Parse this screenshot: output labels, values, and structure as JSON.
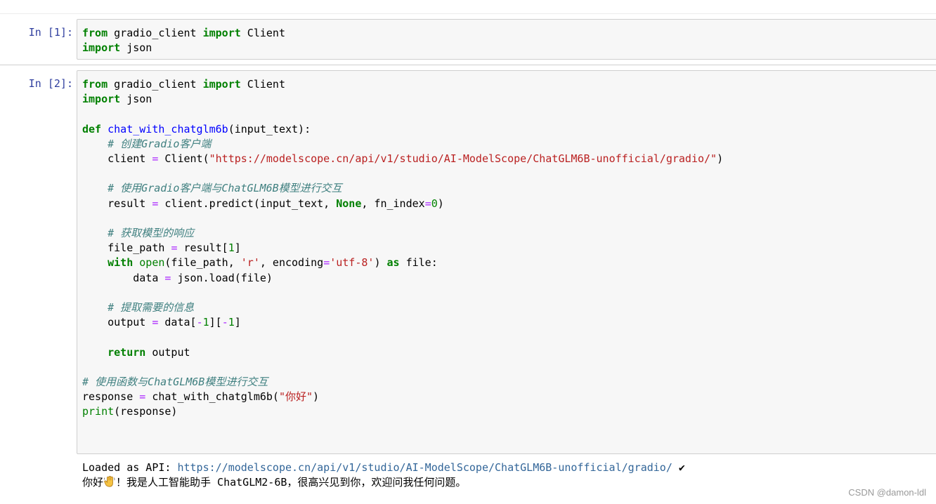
{
  "cells": [
    {
      "prompt": "In  [1]:",
      "code_lines": [
        [
          [
            "kw",
            "from"
          ],
          [
            "t",
            " gradio_client "
          ],
          [
            "kw",
            "import"
          ],
          [
            "t",
            " Client"
          ]
        ],
        [
          [
            "kw",
            "import"
          ],
          [
            "t",
            " json"
          ]
        ]
      ]
    },
    {
      "prompt": "In  [2]:",
      "code_lines": [
        [
          [
            "kw",
            "from"
          ],
          [
            "t",
            " gradio_client "
          ],
          [
            "kw",
            "import"
          ],
          [
            "t",
            " Client"
          ]
        ],
        [
          [
            "kw",
            "import"
          ],
          [
            "t",
            " json"
          ]
        ],
        [],
        [
          [
            "kw",
            "def"
          ],
          [
            "t",
            " "
          ],
          [
            "fn",
            "chat_with_chatglm6b"
          ],
          [
            "t",
            "(input_text):"
          ]
        ],
        [
          [
            "t",
            "    "
          ],
          [
            "cm",
            "# 创建Gradio客户端"
          ]
        ],
        [
          [
            "t",
            "    client "
          ],
          [
            "op",
            "="
          ],
          [
            "t",
            " Client("
          ],
          [
            "str",
            "\"https://modelscope.cn/api/v1/studio/AI-ModelScope/ChatGLM6B-unofficial/gradio/\""
          ],
          [
            "t",
            ")"
          ]
        ],
        [],
        [
          [
            "t",
            "    "
          ],
          [
            "cm",
            "# 使用Gradio客户端与ChatGLM6B模型进行交互"
          ]
        ],
        [
          [
            "t",
            "    result "
          ],
          [
            "op",
            "="
          ],
          [
            "t",
            " client.predict(input_text, "
          ],
          [
            "kw",
            "None"
          ],
          [
            "t",
            ", fn_index"
          ],
          [
            "op",
            "="
          ],
          [
            "num",
            "0"
          ],
          [
            "t",
            ")"
          ]
        ],
        [],
        [
          [
            "t",
            "    "
          ],
          [
            "cm",
            "# 获取模型的响应"
          ]
        ],
        [
          [
            "t",
            "    file_path "
          ],
          [
            "op",
            "="
          ],
          [
            "t",
            " result["
          ],
          [
            "num",
            "1"
          ],
          [
            "t",
            "]"
          ]
        ],
        [
          [
            "t",
            "    "
          ],
          [
            "kw",
            "with"
          ],
          [
            "t",
            " "
          ],
          [
            "bi",
            "open"
          ],
          [
            "t",
            "(file_path, "
          ],
          [
            "str",
            "'r'"
          ],
          [
            "t",
            ", encoding"
          ],
          [
            "op",
            "="
          ],
          [
            "str",
            "'utf-8'"
          ],
          [
            "t",
            ") "
          ],
          [
            "kw",
            "as"
          ],
          [
            "t",
            " file:"
          ]
        ],
        [
          [
            "t",
            "        data "
          ],
          [
            "op",
            "="
          ],
          [
            "t",
            " json.load(file)"
          ]
        ],
        [],
        [
          [
            "t",
            "    "
          ],
          [
            "cm",
            "# 提取需要的信息"
          ]
        ],
        [
          [
            "t",
            "    output "
          ],
          [
            "op",
            "="
          ],
          [
            "t",
            " data["
          ],
          [
            "op",
            "-"
          ],
          [
            "num",
            "1"
          ],
          [
            "t",
            "]["
          ],
          [
            "op",
            "-"
          ],
          [
            "num",
            "1"
          ],
          [
            "t",
            "]"
          ]
        ],
        [],
        [
          [
            "t",
            "    "
          ],
          [
            "kw",
            "return"
          ],
          [
            "t",
            " output"
          ]
        ],
        [],
        [
          [
            "cm",
            "# 使用函数与ChatGLM6B模型进行交互"
          ]
        ],
        [
          [
            "t",
            "response "
          ],
          [
            "op",
            "="
          ],
          [
            "t",
            " chat_with_chatglm6b("
          ],
          [
            "str",
            "\"你好\""
          ],
          [
            "t",
            ")"
          ]
        ],
        [
          [
            "bi",
            "print"
          ],
          [
            "t",
            "(response)"
          ]
        ]
      ]
    }
  ],
  "output": {
    "loaded_prefix": "Loaded as API: ",
    "loaded_url": "https://modelscope.cn/api/v1/studio/AI-ModelScope/ChatGLM6B-unofficial/gradio/",
    "check_mark": " ✔",
    "reply_start": "你好",
    "wave_icon": "waving-hand-icon",
    "reply_rest": "！我是人工智能助手 ChatGLM2-6B，很高兴见到你，欢迎问我任何问题。"
  },
  "watermark": "CSDN @damon-ldl"
}
